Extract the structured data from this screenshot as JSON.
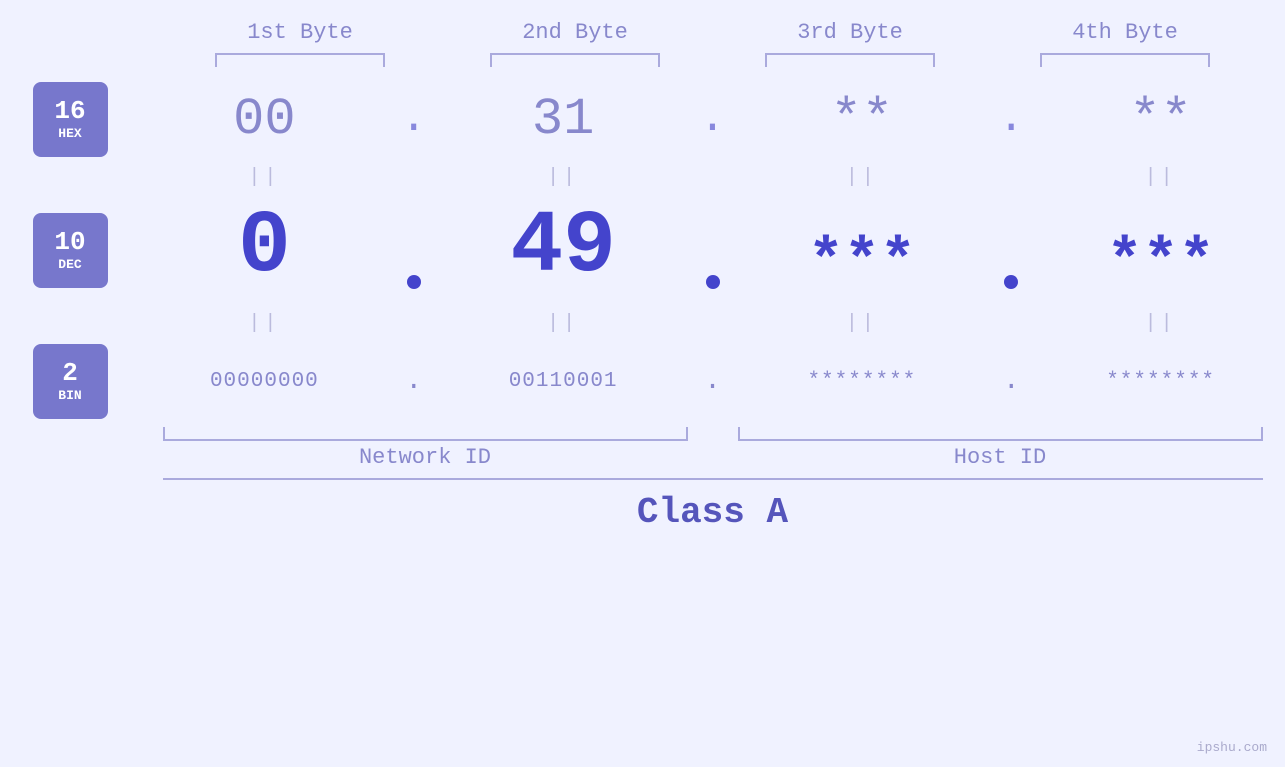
{
  "header": {
    "byte1": "1st Byte",
    "byte2": "2nd Byte",
    "byte3": "3rd Byte",
    "byte4": "4th Byte"
  },
  "badges": {
    "hex": {
      "num": "16",
      "label": "HEX"
    },
    "dec": {
      "num": "10",
      "label": "DEC"
    },
    "bin": {
      "num": "2",
      "label": "BIN"
    }
  },
  "hex_row": {
    "b1": "00",
    "b2": "31",
    "b3": "**",
    "b4": "**",
    "sep": "."
  },
  "dec_row": {
    "b1": "0",
    "b2": "49",
    "b3": "***",
    "b4": "***",
    "sep": "."
  },
  "bin_row": {
    "b1": "00000000",
    "b2": "00110001",
    "b3": "********",
    "b4": "********",
    "sep": "."
  },
  "labels": {
    "network_id": "Network ID",
    "host_id": "Host ID"
  },
  "class_label": "Class A",
  "watermark": "ipshu.com",
  "equals": "||"
}
